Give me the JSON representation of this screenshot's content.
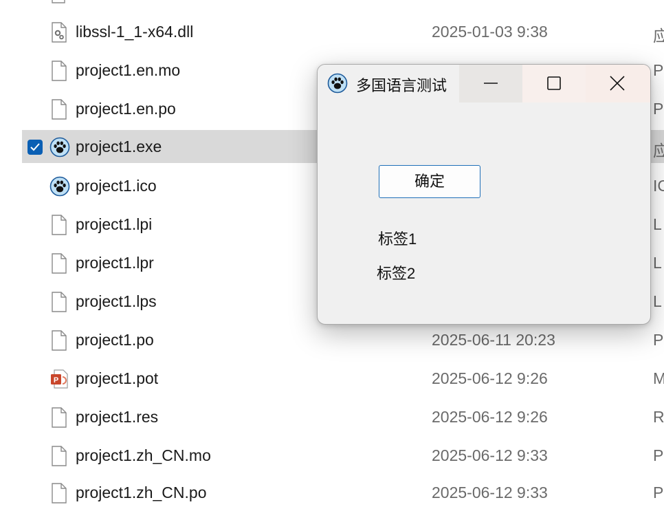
{
  "explorer": {
    "files": [
      {
        "name": "libssl-1_1-x64.dll",
        "date": "2025-01-03 9:38",
        "type": "应",
        "icon": "dll-file-icon"
      },
      {
        "name": "project1.en.mo",
        "date": "",
        "type": "P",
        "icon": "generic-file-icon"
      },
      {
        "name": "project1.en.po",
        "date": "",
        "type": "P",
        "icon": "generic-file-icon"
      },
      {
        "name": "project1.exe",
        "date": "",
        "type": "应",
        "icon": "lazarus-paw-icon",
        "selected": true
      },
      {
        "name": "project1.ico",
        "date": "",
        "type": "IC",
        "icon": "lazarus-paw-icon"
      },
      {
        "name": "project1.lpi",
        "date": "",
        "type": "L",
        "icon": "generic-file-icon"
      },
      {
        "name": "project1.lpr",
        "date": "",
        "type": "L",
        "icon": "generic-file-icon"
      },
      {
        "name": "project1.lps",
        "date": "",
        "type": "L",
        "icon": "generic-file-icon"
      },
      {
        "name": "project1.po",
        "date": "2025-06-11 20:23",
        "type": "P",
        "icon": "generic-file-icon"
      },
      {
        "name": "project1.pot",
        "date": "2025-06-12 9:26",
        "type": "M",
        "icon": "powerpoint-file-icon"
      },
      {
        "name": "project1.res",
        "date": "2025-06-12 9:26",
        "type": "R",
        "icon": "generic-file-icon"
      },
      {
        "name": "project1.zh_CN.mo",
        "date": "2025-06-12 9:33",
        "type": "P",
        "icon": "generic-file-icon"
      },
      {
        "name": "project1.zh_CN.po",
        "date": "2025-06-12 9:33",
        "type": "P",
        "icon": "generic-file-icon"
      }
    ]
  },
  "dialog": {
    "title": "多国语言测试",
    "app_icon": "lazarus-paw-icon",
    "ok_button": "确定",
    "label1": "标签1",
    "label2": "标签2"
  },
  "colors": {
    "selection": "#d9d9d9",
    "checkbox": "#0a5fb4",
    "button_border": "#1e6fb8",
    "date_text": "#6a6a6a"
  }
}
